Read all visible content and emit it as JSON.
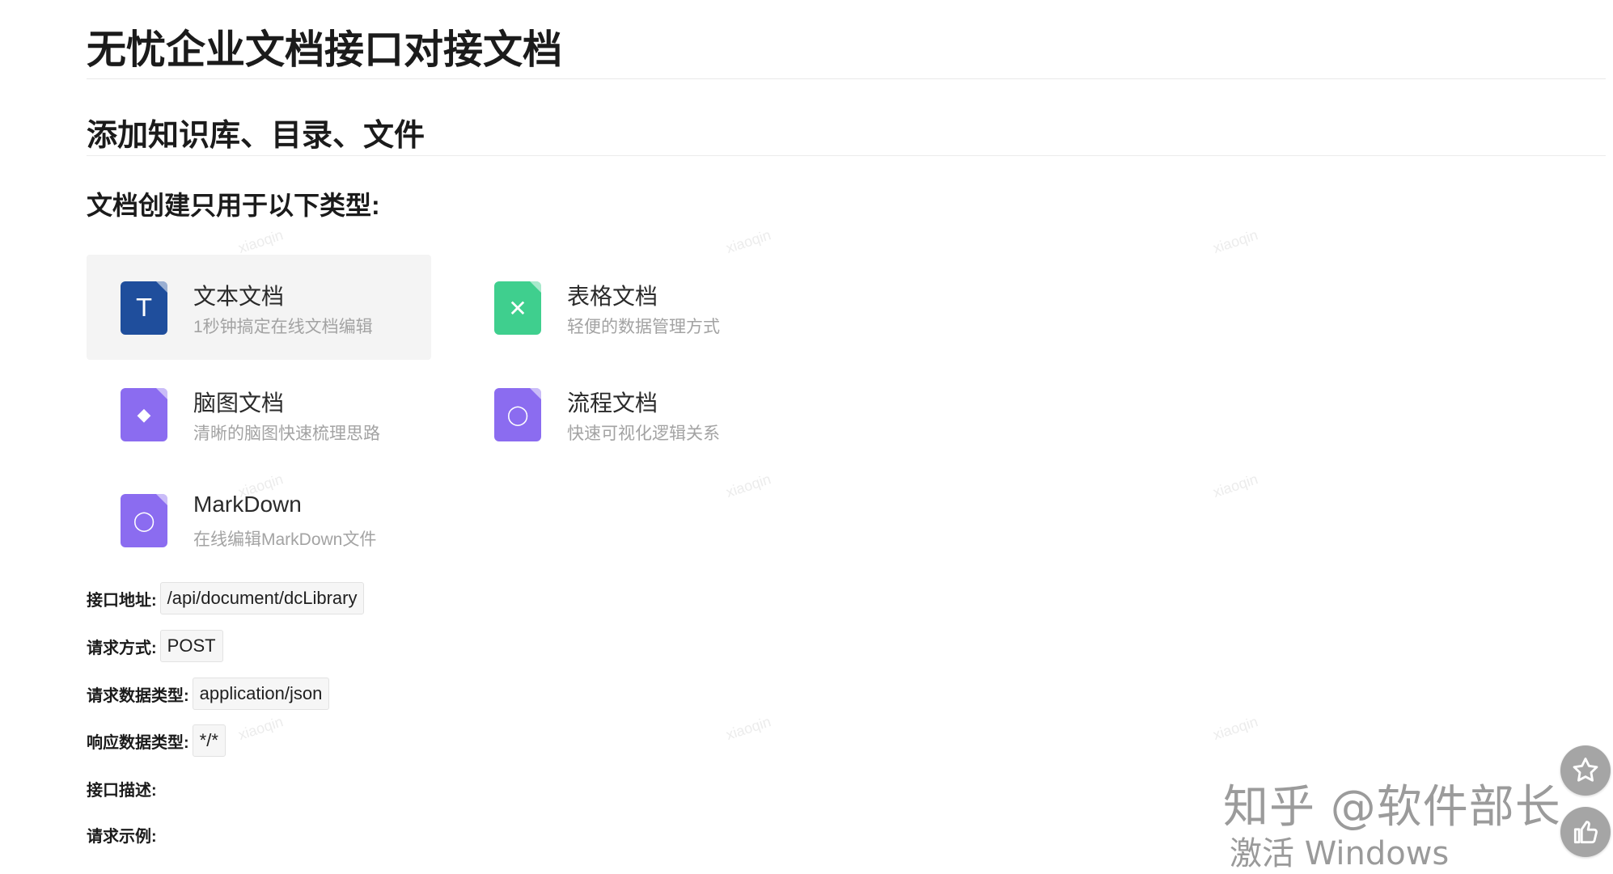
{
  "doc": {
    "title": "无忧企业文档接口对接文档",
    "section_title": "添加知识库、目录、文件",
    "subsection_title": "文档创建只用于以下类型:"
  },
  "doc_types": [
    {
      "title": "文本文档",
      "desc": "1秒钟搞定在线文档编辑",
      "icon": "text-doc-icon",
      "glyph": "T",
      "color": "#1f4e9c"
    },
    {
      "title": "表格文档",
      "desc": "轻便的数据管理方式",
      "icon": "sheet-doc-icon",
      "glyph": "✕",
      "color": "#3fcf8e"
    },
    {
      "title": "脑图文档",
      "desc": "清晰的脑图快速梳理思路",
      "icon": "mindmap-doc-icon",
      "glyph": "◆",
      "color": "#8b6cf0"
    },
    {
      "title": "流程文档",
      "desc": "快速可视化逻辑关系",
      "icon": "flow-doc-icon",
      "glyph": "◯",
      "color": "#8b6cf0"
    },
    {
      "title": "MarkDown",
      "desc": "在线编辑MarkDown文件",
      "icon": "markdown-doc-icon",
      "glyph": "◯",
      "color": "#8b6cf0"
    }
  ],
  "api": {
    "url_label": "接口地址:",
    "url_value": "/api/document/dcLibrary",
    "method_label": "请求方式:",
    "method_value": "POST",
    "req_type_label": "请求数据类型:",
    "req_type_value": "application/json",
    "resp_type_label": "响应数据类型:",
    "resp_type_value": "*/*",
    "desc_label": "接口描述:",
    "example_label": "请求示例:"
  },
  "watermark_text": "xiaoqin",
  "overlay": {
    "zhihu_text": "知乎 @软件部长",
    "activate_text": "激活 Windows"
  }
}
